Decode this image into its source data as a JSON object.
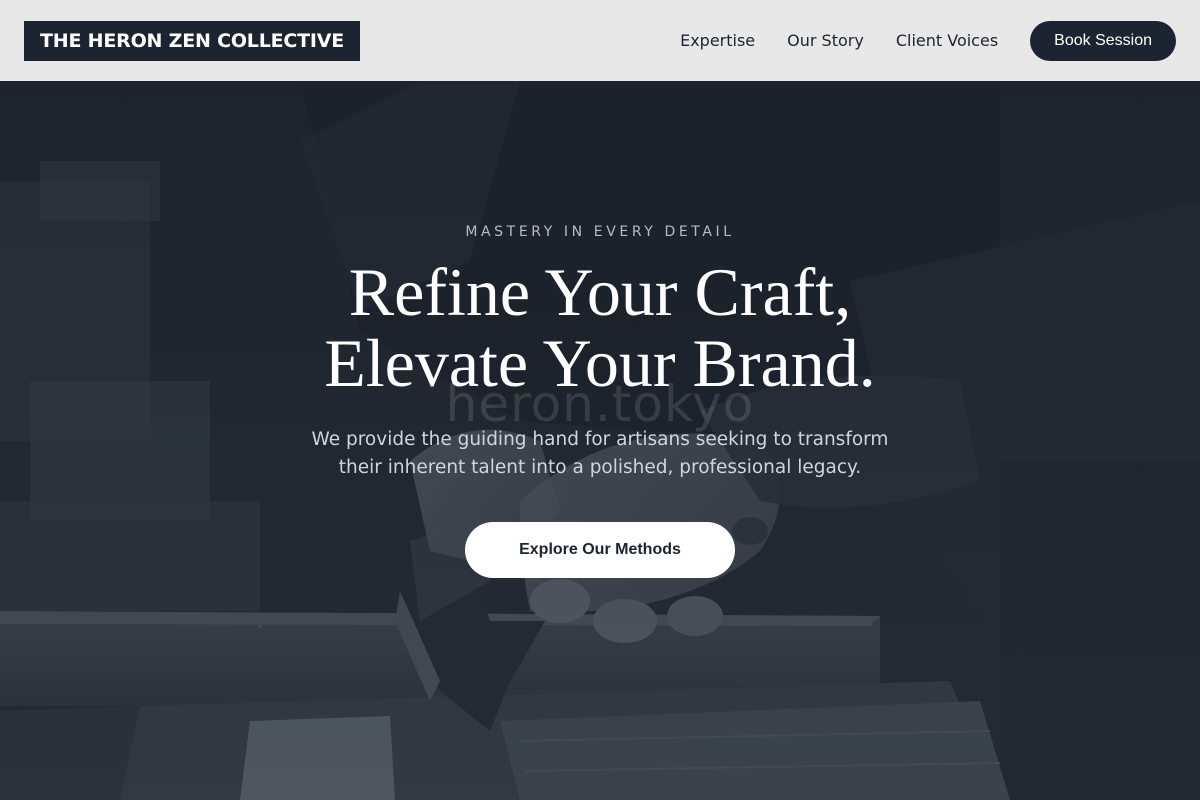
{
  "header": {
    "logo_text": "THE HERON ZEN COLLECTIVE",
    "nav": [
      {
        "label": "Expertise"
      },
      {
        "label": "Our Story"
      },
      {
        "label": "Client Voices"
      }
    ],
    "cta_label": "Book Session"
  },
  "hero": {
    "eyebrow": "MASTERY IN EVERY DETAIL",
    "headline_line1": "Refine Your Craft,",
    "headline_line2": "Elevate Your Brand.",
    "subtext_line1": "We provide the guiding hand for artisans seeking to transform",
    "subtext_line2": "their inherent talent into a polished, professional legacy.",
    "cta_label": "Explore Our Methods",
    "watermark": "heron.tokyo"
  },
  "colors": {
    "brand_dark": "#1b2430",
    "header_bg": "#e8e8e8",
    "hero_text": "#ffffff",
    "eyebrow_text": "#b4bcc8"
  }
}
